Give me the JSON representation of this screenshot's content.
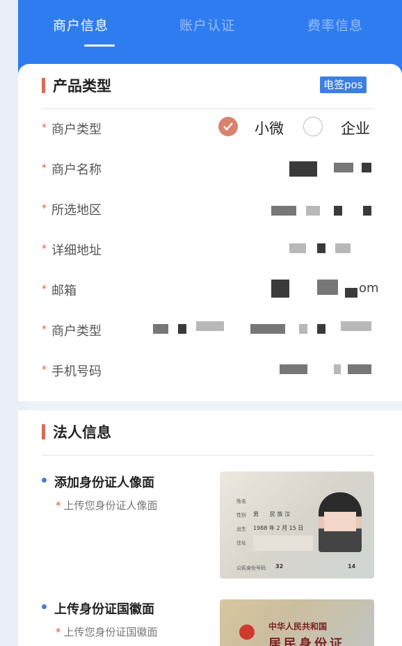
{
  "tabs": [
    {
      "label": "商户信息",
      "active": true
    },
    {
      "label": "账户认证",
      "active": false
    },
    {
      "label": "费率信息",
      "active": false
    }
  ],
  "product": {
    "section_title": "产品类型",
    "badge": "电签pos"
  },
  "form": {
    "required_mark": "*",
    "fields": [
      {
        "label": "商户类型"
      },
      {
        "label": "商户名称"
      },
      {
        "label": "所选地区"
      },
      {
        "label": "详细地址"
      },
      {
        "label": "邮箱",
        "visible_suffix": "om"
      },
      {
        "label": "商户类型"
      },
      {
        "label": "手机号码"
      }
    ],
    "merchant_type_options": [
      {
        "label": "小微",
        "selected": true
      },
      {
        "label": "企业",
        "selected": false
      }
    ]
  },
  "legal": {
    "section_title": "法人信息",
    "uploads": [
      {
        "title": "添加身份证人像面",
        "hint": "上传您身份证人像面"
      },
      {
        "title": "上传身份证国徽面",
        "hint": "上传您身份证国徽面"
      }
    ],
    "id_front": {
      "gender": "男",
      "ethnicity": "民 族 汉",
      "birth": "1988 年 2 月 15 日",
      "id_prefix": "32",
      "id_suffix": "14",
      "label_name": "姓名",
      "label_gender": "性别",
      "label_birth": "出生",
      "label_address": "住址",
      "label_id": "公民身份号码"
    },
    "id_back": {
      "country": "中华人民共和国",
      "card_title": "居民身份证"
    }
  },
  "colors": {
    "header_blue": "#2f7cf0",
    "accent_red": "#d96b57",
    "badge_blue": "#3d7fe0"
  },
  "icons": {
    "check": "check-icon",
    "bullet": "bullet-icon"
  }
}
